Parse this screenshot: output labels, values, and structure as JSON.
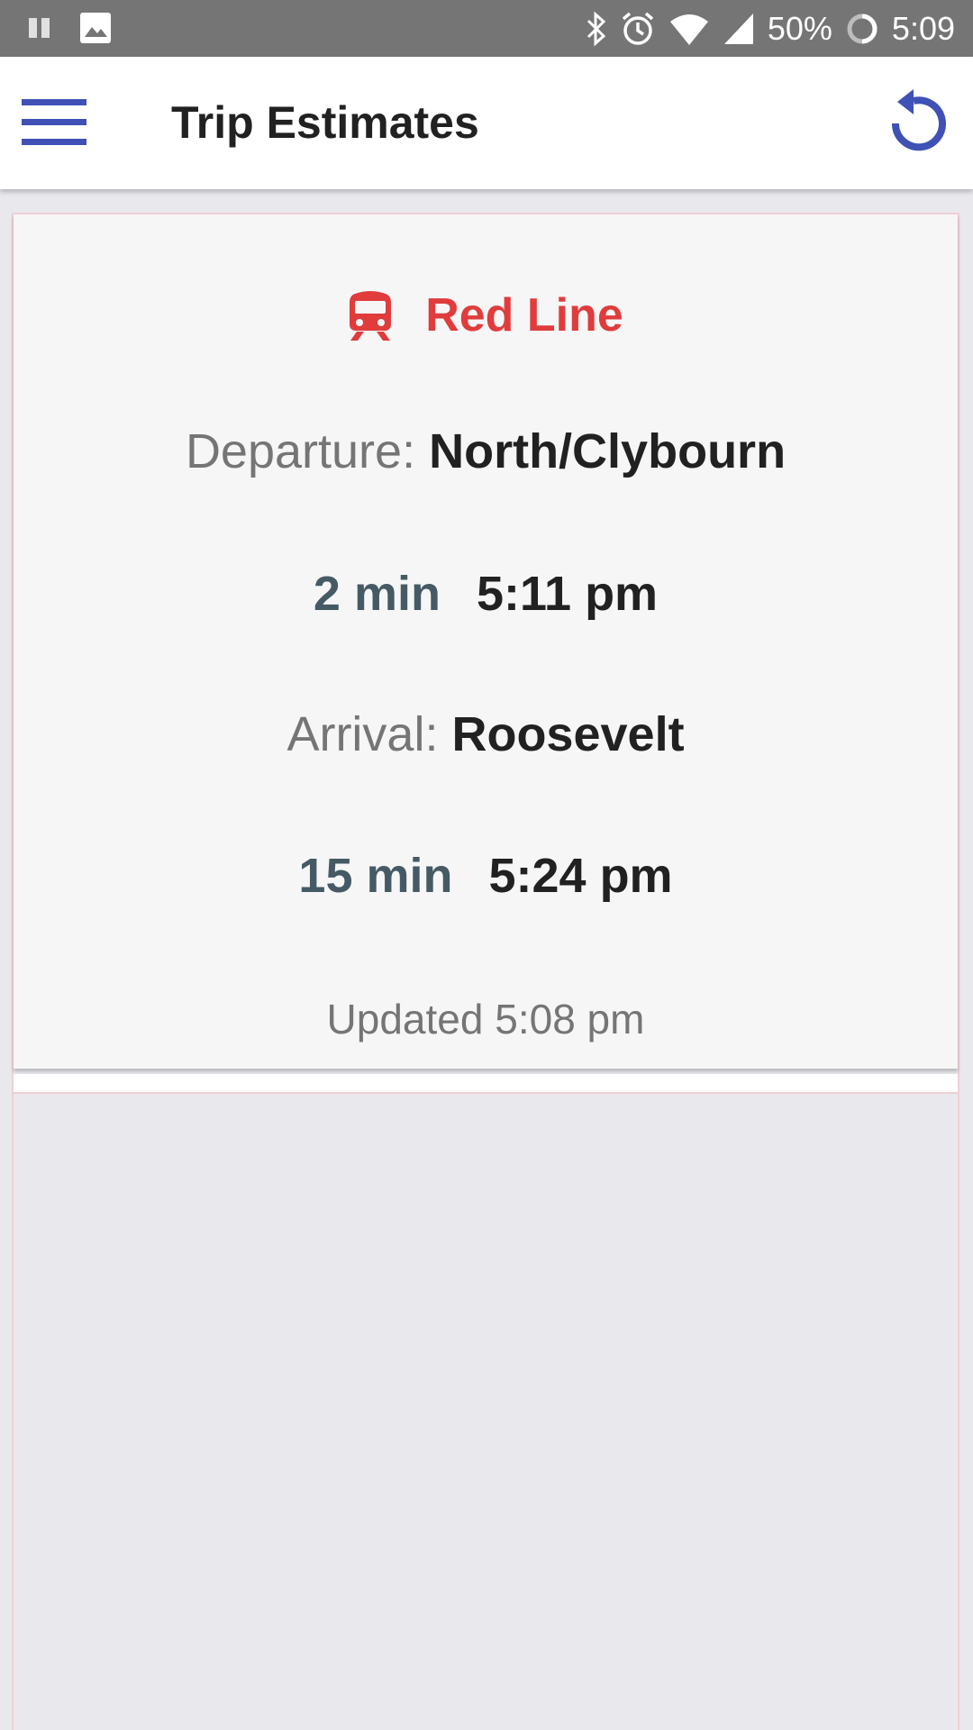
{
  "status_bar": {
    "battery": "50%",
    "time": "5:09",
    "icons": [
      "pause-icon",
      "image-icon",
      "bluetooth-icon",
      "alarm-icon",
      "wifi-icon",
      "signal-icon",
      "battery-icon"
    ]
  },
  "app_bar": {
    "title": "Trip Estimates",
    "menu_icon": "hamburger-menu-icon",
    "refresh_icon": "refresh-icon",
    "accent_color": "#3f51b5"
  },
  "trip": {
    "line_icon": "train-icon",
    "line_name": "Red Line",
    "line_color": "#e03c3c",
    "departure_label": "Departure:",
    "departure_station": "North/Clybourn",
    "departure_minutes": "2 min",
    "departure_time": "5:11 pm",
    "arrival_label": "Arrival:",
    "arrival_station": "Roosevelt",
    "arrival_minutes": "15 min",
    "arrival_time": "5:24 pm",
    "updated": "Updated 5:08 pm"
  }
}
